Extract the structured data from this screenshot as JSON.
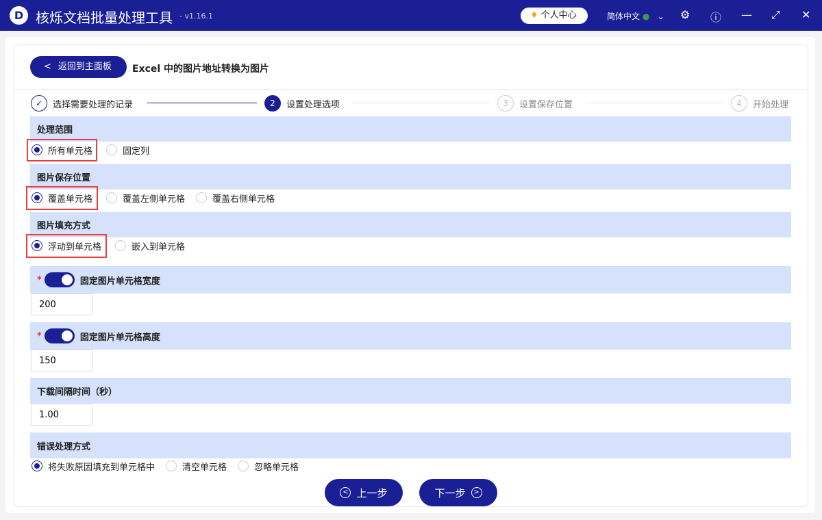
{
  "app": {
    "title": "核烁文档批量处理工具",
    "version": "- v1.16.1",
    "logo": "D",
    "personal_center": "个人中心",
    "language": "简体中文"
  },
  "page": {
    "back_label": "返回到主面板",
    "title": "Excel 中的图片地址转换为图片"
  },
  "steps": [
    {
      "num": "✓",
      "label": "选择需要处理的记录"
    },
    {
      "num": "2",
      "label": "设置处理选项"
    },
    {
      "num": "3",
      "label": "设置保存位置"
    },
    {
      "num": "4",
      "label": "开始处理"
    }
  ],
  "sections": {
    "range": {
      "title": "处理范围",
      "options": [
        "所有单元格",
        "固定列"
      ]
    },
    "save_pos": {
      "title": "图片保存位置",
      "options": [
        "覆盖单元格",
        "覆盖左侧单元格",
        "覆盖右侧单元格"
      ]
    },
    "fill": {
      "title": "图片填充方式",
      "options": [
        "浮动到单元格",
        "嵌入到单元格"
      ]
    },
    "width": {
      "title": "固定图片单元格宽度",
      "value": "200",
      "enabled": true
    },
    "height": {
      "title": "固定图片单元格高度",
      "value": "150",
      "enabled": true
    },
    "interval": {
      "title": "下载间隔时间（秒）",
      "value": "1.00"
    },
    "error": {
      "title": "错误处理方式",
      "options": [
        "将失败原因填充到单元格中",
        "清空单元格",
        "忽略单元格"
      ]
    }
  },
  "required_mark": "*",
  "nav": {
    "prev": "上一步",
    "next": "下一步"
  }
}
